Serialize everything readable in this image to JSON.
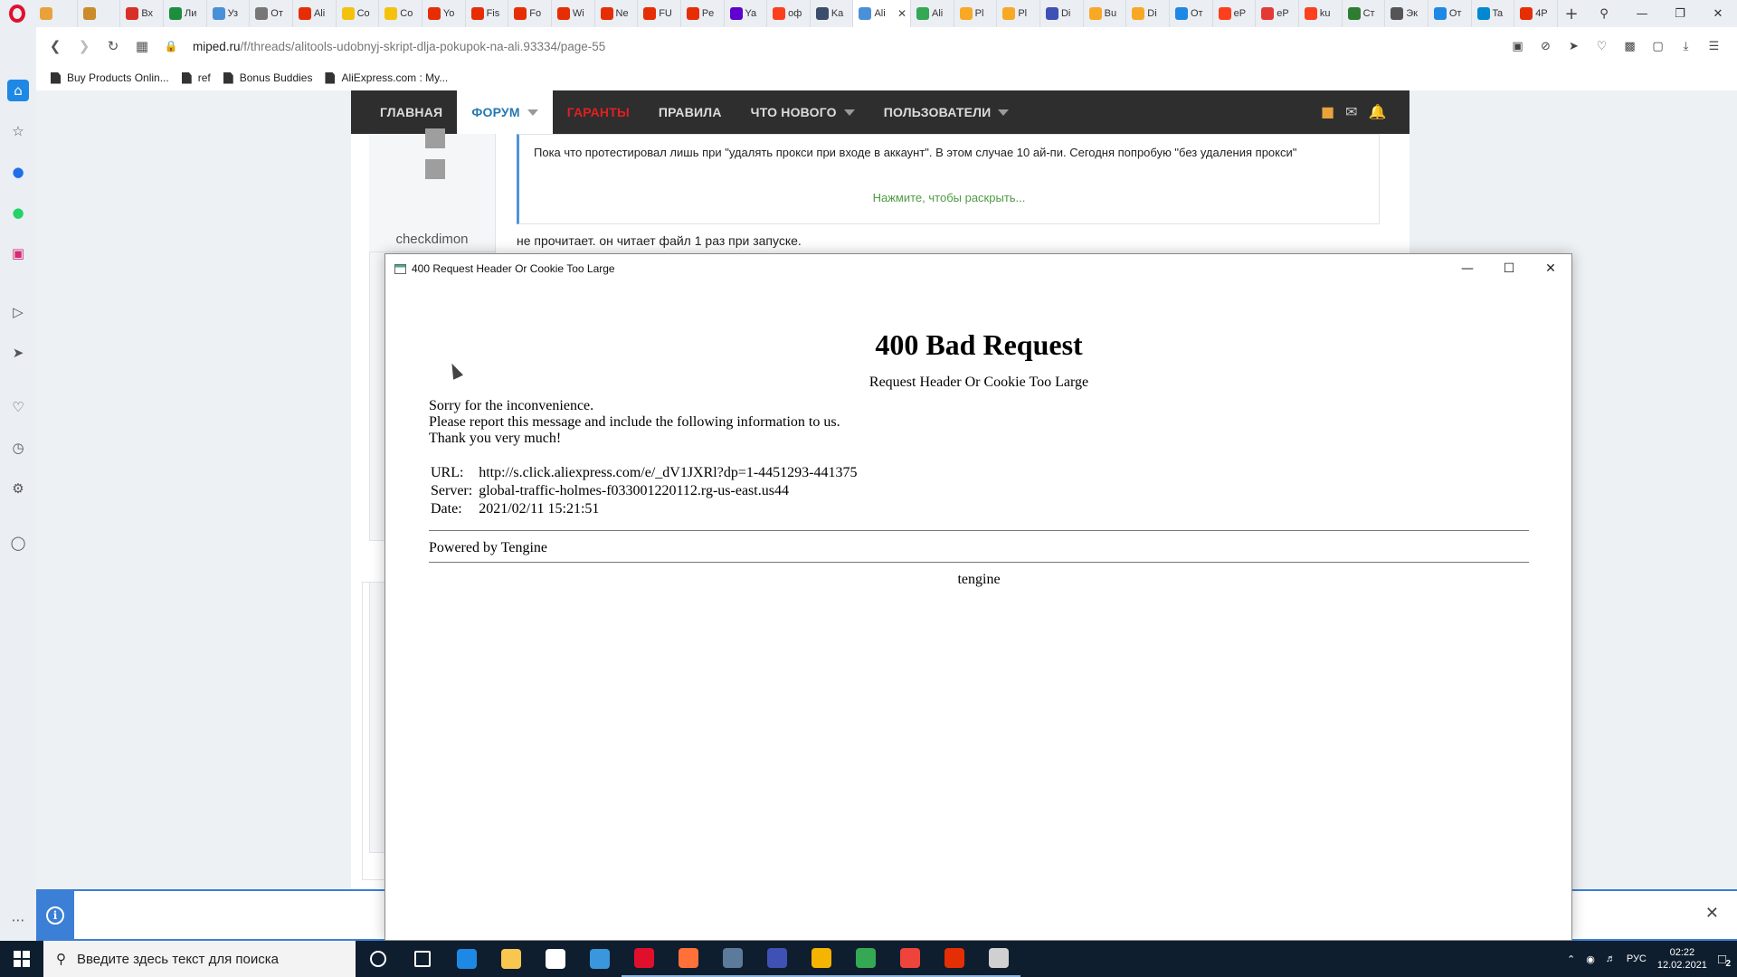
{
  "browser": {
    "tabs": [
      {
        "label": "",
        "color": "#e9a23b"
      },
      {
        "label": "",
        "color": "#c98b2b"
      },
      {
        "label": "Вх",
        "color": "#d93025"
      },
      {
        "label": "Ли",
        "color": "#1e8e3e"
      },
      {
        "label": "Уз",
        "color": "#4a90d9"
      },
      {
        "label": "От",
        "color": "#777777"
      },
      {
        "label": "Ali",
        "color": "#e62e04"
      },
      {
        "label": "Co",
        "color": "#f4c20d"
      },
      {
        "label": "Co",
        "color": "#f4c20d"
      },
      {
        "label": "Yo",
        "color": "#e62e04"
      },
      {
        "label": "Fis",
        "color": "#e62e04"
      },
      {
        "label": "Fo",
        "color": "#e62e04"
      },
      {
        "label": "Wi",
        "color": "#e62e04"
      },
      {
        "label": "Ne",
        "color": "#e62e04"
      },
      {
        "label": "FU",
        "color": "#e62e04"
      },
      {
        "label": "Pe",
        "color": "#e62e04"
      },
      {
        "label": "Ya",
        "color": "#5f01d1"
      },
      {
        "label": "оф",
        "color": "#fc3f1d"
      },
      {
        "label": "Ka",
        "color": "#3c4d6b"
      },
      {
        "label": "Ali",
        "color": "#4a90d9",
        "active": true
      },
      {
        "label": "Ali",
        "color": "#34a853"
      },
      {
        "label": "Pl",
        "color": "#f9a825"
      },
      {
        "label": "Pl",
        "color": "#f9a825"
      },
      {
        "label": "Di",
        "color": "#3f51b5"
      },
      {
        "label": "Bu",
        "color": "#f9a825"
      },
      {
        "label": "Di",
        "color": "#f9a825"
      },
      {
        "label": "От",
        "color": "#1e88e5"
      },
      {
        "label": "eP",
        "color": "#fc3f1d"
      },
      {
        "label": "eP",
        "color": "#e53935"
      },
      {
        "label": "ku",
        "color": "#fc3f1d"
      },
      {
        "label": "Ст",
        "color": "#2e7d32"
      },
      {
        "label": "Эк",
        "color": "#555555"
      },
      {
        "label": "От",
        "color": "#1e88e5"
      },
      {
        "label": "Ta",
        "color": "#0288d1"
      },
      {
        "label": "4P",
        "color": "#e62e04"
      }
    ],
    "url_domain": "miped.ru",
    "url_path": "/f/threads/alitools-udobnyj-skript-dlja-pokupok-na-ali.93334/page-55",
    "bookmarks": [
      "Buy Products Onlin...",
      "ref",
      "Bonus Buddies",
      "AliExpress.com : My..."
    ]
  },
  "forum": {
    "nav": [
      {
        "label": "ГЛАВНАЯ"
      },
      {
        "label": "ФОРУМ",
        "selected": true,
        "dropdown": true
      },
      {
        "label": "ГАРАНТЫ",
        "red": true
      },
      {
        "label": "ПРАВИЛА"
      },
      {
        "label": "ЧТО НОВОГО",
        "dropdown": true
      },
      {
        "label": "ПОЛЬЗОВАТЕЛИ",
        "dropdown": true
      }
    ],
    "quote_text": "Пока что протестировал лишь при \"удалять прокси при входе в аккаунт\". В этом случае 10 ай-пи. Сегодня попробую \"без удаления прокси\"",
    "quote_expand": "Нажмите, чтобы раскрыть...",
    "username": "checkdimon",
    "post_text": "не прочитает. он читает файл 1 раз при запуске."
  },
  "popup": {
    "title": "400 Request Header Or Cookie Too Large",
    "heading": "400 Bad Request",
    "subheading": "Request Header Or Cookie Too Large",
    "lines": [
      "Sorry for the inconvenience.",
      "Please report this message and include the following information to us.",
      "Thank you very much!"
    ],
    "info": [
      {
        "label": "URL:",
        "value": "http://s.click.aliexpress.com/e/_dV1JXRl?dp=1-4451293-441375"
      },
      {
        "label": "Server:",
        "value": "global-traffic-holmes-f033001220112.rg-us-east.us44"
      },
      {
        "label": "Date:",
        "value": "2021/02/11 15:21:51"
      }
    ],
    "powered": "Powered by Tengine",
    "footer": "tengine"
  },
  "taskbar": {
    "search_placeholder": "Введите здесь текст для поиска",
    "apps": [
      {
        "name": "cortana-icon",
        "color": "#ffffff"
      },
      {
        "name": "task-view-icon",
        "color": "#ffffff"
      },
      {
        "name": "edge-icon",
        "color": "#1e88e5"
      },
      {
        "name": "file-explorer-icon",
        "color": "#f9c74f"
      },
      {
        "name": "store-icon",
        "color": "#ffffff"
      },
      {
        "name": "mail-icon",
        "color": "#3a96dd"
      },
      {
        "name": "opera-icon",
        "color": "#e0102d"
      },
      {
        "name": "firefox-icon",
        "color": "#ff7139"
      },
      {
        "name": "calculator-icon",
        "color": "#5c7a99"
      },
      {
        "name": "save-app-icon",
        "color": "#3f51b5"
      },
      {
        "name": "chrome-dev-icon",
        "color": "#f4b400"
      },
      {
        "name": "chrome-icon",
        "color": "#34a853"
      },
      {
        "name": "anydesk-icon",
        "color": "#ef443b"
      },
      {
        "name": "aliexpress-icon",
        "color": "#e62e04"
      },
      {
        "name": "window-app-icon",
        "color": "#d0d0d0"
      }
    ],
    "language": "РУС",
    "time": "02:22",
    "date": "12.02.2021",
    "notification_count": "2"
  }
}
